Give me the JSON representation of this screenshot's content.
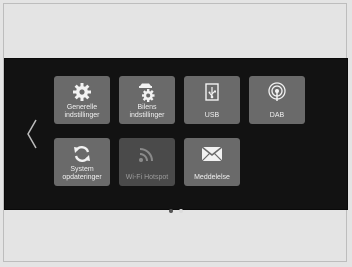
{
  "menu": {
    "tiles": [
      {
        "id": "general",
        "label_1": "Generelle",
        "label_2": "indstillinger",
        "icon": "gear-icon"
      },
      {
        "id": "vehicle",
        "label_1": "Bilens",
        "label_2": "indstillinger",
        "icon": "car-settings-icon"
      },
      {
        "id": "usb",
        "label_1": "USB",
        "icon": "usb-icon"
      },
      {
        "id": "dab",
        "label_1": "DAB",
        "icon": "dab-icon"
      },
      {
        "id": "system",
        "label_1": "System",
        "label_2": "opdateringer",
        "icon": "refresh-icon"
      },
      {
        "id": "wifi",
        "label_1": "Wi-Fi Hotspot",
        "icon": "wifi-icon",
        "state": "disabled"
      },
      {
        "id": "message",
        "label_1": "Meddelelse",
        "icon": "envelope-icon"
      }
    ],
    "pagination": {
      "pages": 2,
      "current": 2
    }
  }
}
